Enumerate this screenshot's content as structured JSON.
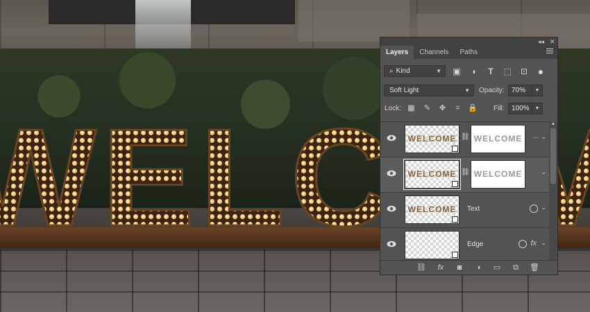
{
  "panel": {
    "tabs": [
      "Layers",
      "Channels",
      "Paths"
    ],
    "filter": {
      "label": "Kind"
    },
    "blend_mode": "Soft Light",
    "opacity": {
      "label": "Opacity:",
      "value": "70%"
    },
    "lock": {
      "label": "Lock:"
    },
    "fill": {
      "label": "Fill:",
      "value": "100%"
    },
    "layers": [
      {
        "thumb_text": "WELCOME",
        "mask_text": "WELCOME",
        "dots": "...",
        "selected": false
      },
      {
        "thumb_text": "WELCOME",
        "mask_text": "WELCOME",
        "selected": true
      },
      {
        "thumb_text": "WELCOME",
        "name": "Text",
        "selected": false
      },
      {
        "thumb_text": "",
        "name": "Edge",
        "fx": "fx",
        "selected": false
      }
    ],
    "bottom": {
      "fx": "fx"
    }
  },
  "background": {
    "sign_text": "WELCOME"
  }
}
